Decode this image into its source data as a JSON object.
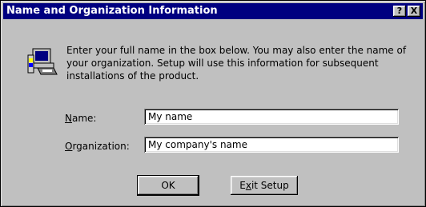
{
  "dialog": {
    "title": "Name and Organization Information",
    "help_glyph": "?",
    "close_glyph": "X",
    "icon": "computer-setup-icon",
    "message": "Enter your full name in the box below. You may also enter the name of your organization. Setup will use this information for subsequent installations of the product."
  },
  "form": {
    "name_label_prefix": "N",
    "name_label_rest": "ame:",
    "name_value": "My name",
    "org_label_prefix": "O",
    "org_label_rest": "rganization:",
    "org_value": "My company's name"
  },
  "buttons": {
    "ok_label": "OK",
    "exit_prefix": "E",
    "exit_ul": "x",
    "exit_rest": "it Setup"
  },
  "colors": {
    "titlebar": "#000080",
    "face": "#c0c0c0"
  }
}
